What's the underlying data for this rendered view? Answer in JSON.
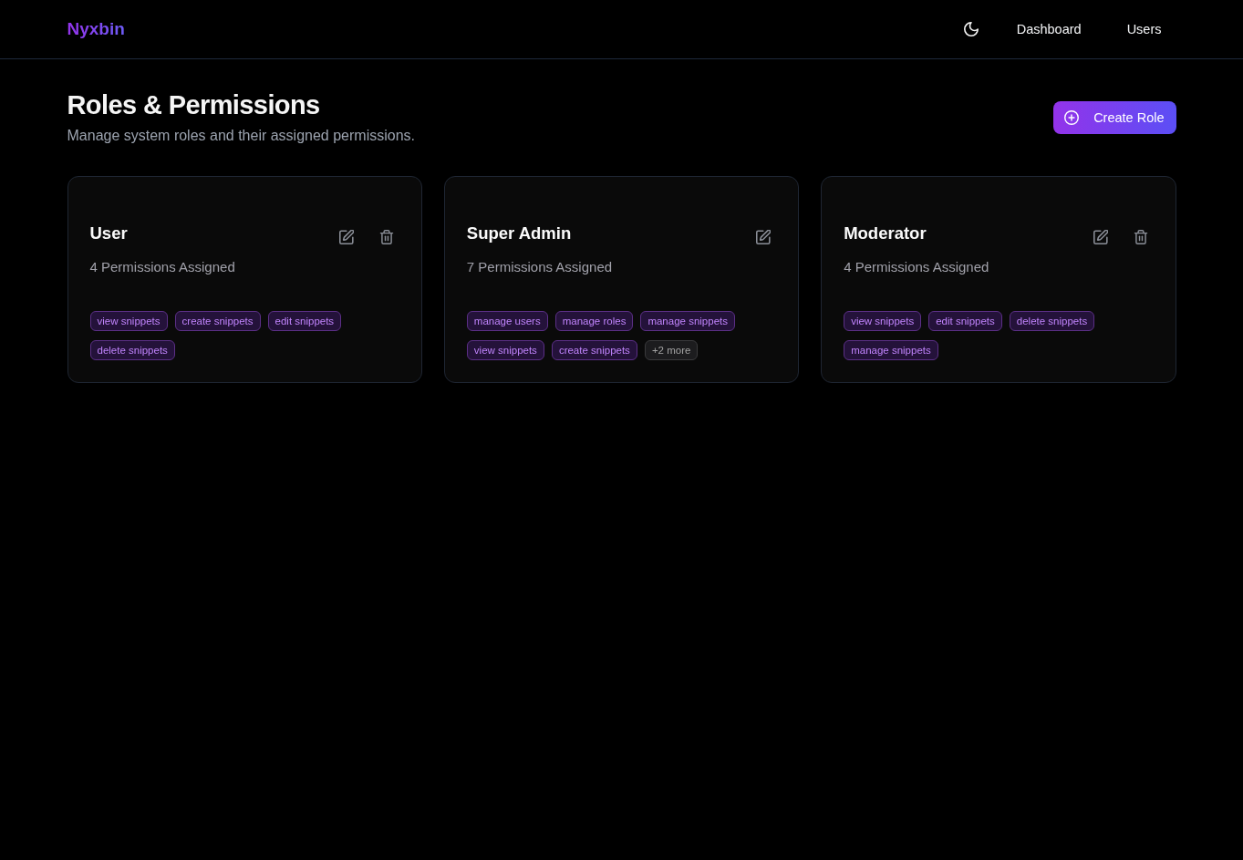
{
  "header": {
    "logo": "Nyxbin",
    "nav": [
      "Dashboard",
      "Users"
    ]
  },
  "heading": {
    "title": "Roles & Permissions",
    "subtitle": "Manage system roles and their assigned permissions.",
    "create_button": "Create Role"
  },
  "roles": [
    {
      "name": "User",
      "count": "4 Permissions Assigned",
      "deletable": true,
      "tags": [
        {
          "kind": "permission",
          "label": "view snippets"
        },
        {
          "kind": "permission",
          "label": "create snippets"
        },
        {
          "kind": "permission",
          "label": "edit snippets"
        },
        {
          "kind": "permission",
          "label": "delete snippets"
        }
      ]
    },
    {
      "name": "Super Admin",
      "count": "7 Permissions Assigned",
      "deletable": false,
      "tags": [
        {
          "kind": "permission",
          "label": "manage users"
        },
        {
          "kind": "permission",
          "label": "manage roles"
        },
        {
          "kind": "permission",
          "label": "manage snippets"
        },
        {
          "kind": "permission",
          "label": "view snippets"
        },
        {
          "kind": "permission",
          "label": "create snippets"
        },
        {
          "kind": "more",
          "label": "+2 more"
        }
      ]
    },
    {
      "name": "Moderator",
      "count": "4 Permissions Assigned",
      "deletable": true,
      "tags": [
        {
          "kind": "permission",
          "label": "view snippets"
        },
        {
          "kind": "permission",
          "label": "edit snippets"
        },
        {
          "kind": "permission",
          "label": "delete snippets"
        },
        {
          "kind": "permission",
          "label": "manage snippets"
        }
      ]
    }
  ]
}
